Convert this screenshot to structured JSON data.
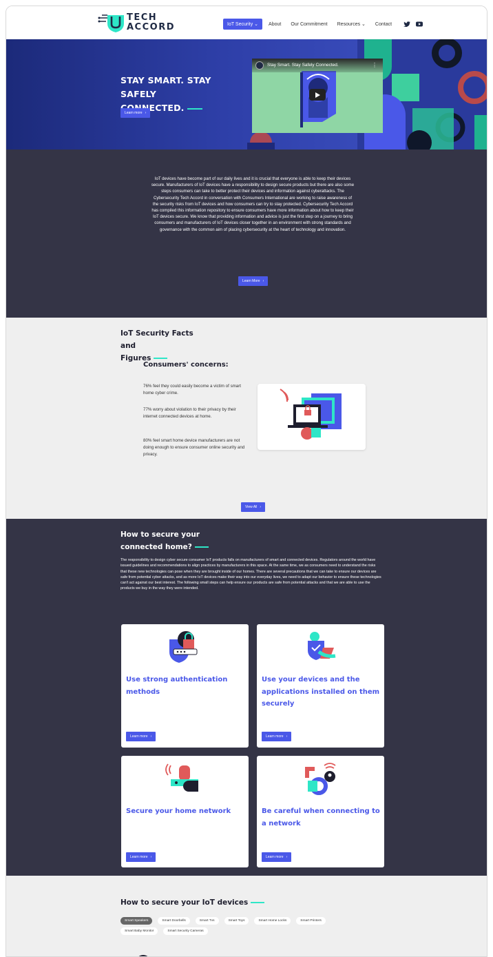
{
  "brand": {
    "line1": "TECH",
    "line2": "ACCORD"
  },
  "nav": {
    "items": [
      {
        "label": "IoT Security ⌄",
        "active": true
      },
      {
        "label": "About",
        "active": false
      },
      {
        "label": "Our Commitment",
        "active": false
      },
      {
        "label": "Resources ⌄",
        "active": false
      },
      {
        "label": "Contact",
        "active": false
      }
    ],
    "social": [
      "twitter-icon",
      "youtube-icon"
    ]
  },
  "hero": {
    "line1": "STAY SMART. STAY SAFELY",
    "line2": "CONNECTED.",
    "button": "Learn more",
    "video_title": "Stay Smart. Stay Safely Connected."
  },
  "intro": {
    "text": "IoT devices have become part of our daily lives and it is crucial that everyone is able to keep their devices secure. Manufacturers of IoT devices have a responsibility to design secure products but there are also some steps consumers can take to better protect their devices and information against cyberattacks. The Cybersecurity Tech Accord in conversation with Consumers International are working to raise awareness of the security risks from IoT devices and how consumers can try to stay protected. Cybersecurity Tech Accord has compiled this information repository to ensure consumers have more information about how to keep their IoT devices secure. We know that providing information and advice is just the first step on a journey to bring consumers and manufacturers of IoT devices closer together in an environment with strong standards and governance with the common aim of placing cybersecurity at the heart of technology and innovation.",
    "button": "Learn More"
  },
  "facts": {
    "title_line1": "IoT Security Facts and",
    "title_line2": "Figures",
    "concerns_title": "Consumers' concerns:",
    "stats": [
      "76% feel they could easily become a victim of smart home cyber crime.",
      "77% worry about violation to their privacy by their internet connected devices at home.",
      "80% feel smart home device manufacturers are not doing enough to ensure consumer online security and privacy."
    ],
    "button": "View All"
  },
  "home": {
    "title_line1": "How to secure your",
    "title_line2": "connected home?",
    "text": "The responsibility to design cyber secure consumer IoT products falls on manufacturers of smart and connected devices. Regulators around the world have issued guidelines and recommendations to align practices by manufacturers in this space. At the same time, we as consumers need to understand the risks that these new technologies can pose when they are brought inside of our homes. There are several precautions that we can take to ensure our devices are safe from potential cyber attacks, and as more IoT devices make their way into our everyday lives, we need to adapt our behavior to ensure these technologies can't act against our best interest. The following small steps can help ensure our products are safe from potential attacks and that we are able to use the products we buy in the way they were intended.",
    "cards": [
      {
        "title": "Use strong authentication methods",
        "button": "Learn more"
      },
      {
        "title": "Use your devices and the applications installed on them securely",
        "button": "Learn more"
      },
      {
        "title": "Secure your home network",
        "button": "Learn more"
      },
      {
        "title": "Be careful when connecting to a network",
        "button": "Learn more"
      }
    ]
  },
  "devices": {
    "title": "How to secure your IoT devices",
    "chips": [
      "Smart Speakers",
      "Smart Doorbells",
      "Smart Tvs",
      "Smart Toys",
      "Smart Home Locks",
      "Smart Printers",
      "Smart Baby Monitor",
      "Smart Security Cameras"
    ]
  }
}
